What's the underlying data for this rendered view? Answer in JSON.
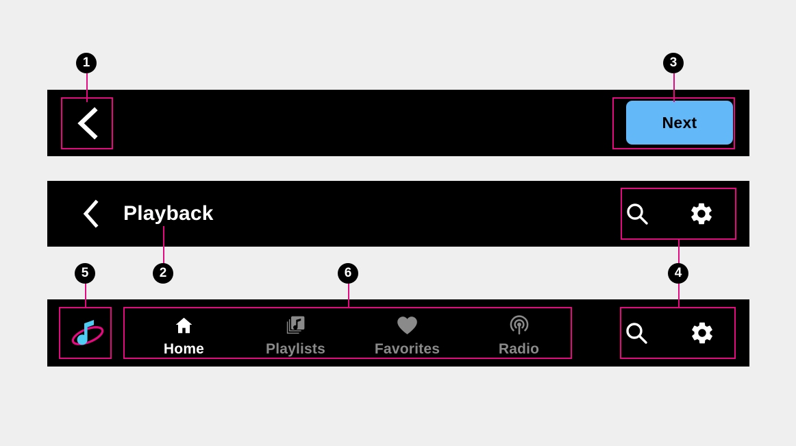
{
  "page": {
    "background_color": "#efefef",
    "bar_color": "#000000",
    "annotation_color": "#e5097f",
    "accent_color": "#63b8f8"
  },
  "top_bar": {
    "back_button": {
      "icon": "chevron-left-icon",
      "label": ""
    },
    "next_button": {
      "label": "Next",
      "background": "#63b8f8",
      "text_color": "#000000"
    }
  },
  "playback_bar": {
    "back_button": {
      "icon": "chevron-left-icon"
    },
    "title": "Playback",
    "actions": [
      {
        "icon": "search-icon",
        "label": "Search"
      },
      {
        "icon": "gear-icon",
        "label": "Settings"
      }
    ]
  },
  "bottom_bar": {
    "logo": {
      "icon": "music-note-orbit-logo",
      "note_color": "#4ecdf4",
      "ring_color": "#e5097f"
    },
    "nav_items": [
      {
        "label": "Home",
        "icon": "home-icon",
        "active": true
      },
      {
        "label": "Playlists",
        "icon": "playlists-icon",
        "active": false
      },
      {
        "label": "Favorites",
        "icon": "heart-icon",
        "active": false
      },
      {
        "label": "Radio",
        "icon": "radio-broadcast-icon",
        "active": false
      }
    ],
    "actions": [
      {
        "icon": "search-icon",
        "label": "Search"
      },
      {
        "icon": "gear-icon",
        "label": "Settings"
      }
    ],
    "active_color": "#ffffff",
    "inactive_color": "#8a8a8a"
  },
  "annotations": [
    {
      "number": "1",
      "target": "top-bar-back-button"
    },
    {
      "number": "2",
      "target": "playback-title"
    },
    {
      "number": "3",
      "target": "next-button"
    },
    {
      "number": "4",
      "target": "header-and-nav-actions"
    },
    {
      "number": "5",
      "target": "brand-logo"
    },
    {
      "number": "6",
      "target": "nav-items"
    }
  ]
}
